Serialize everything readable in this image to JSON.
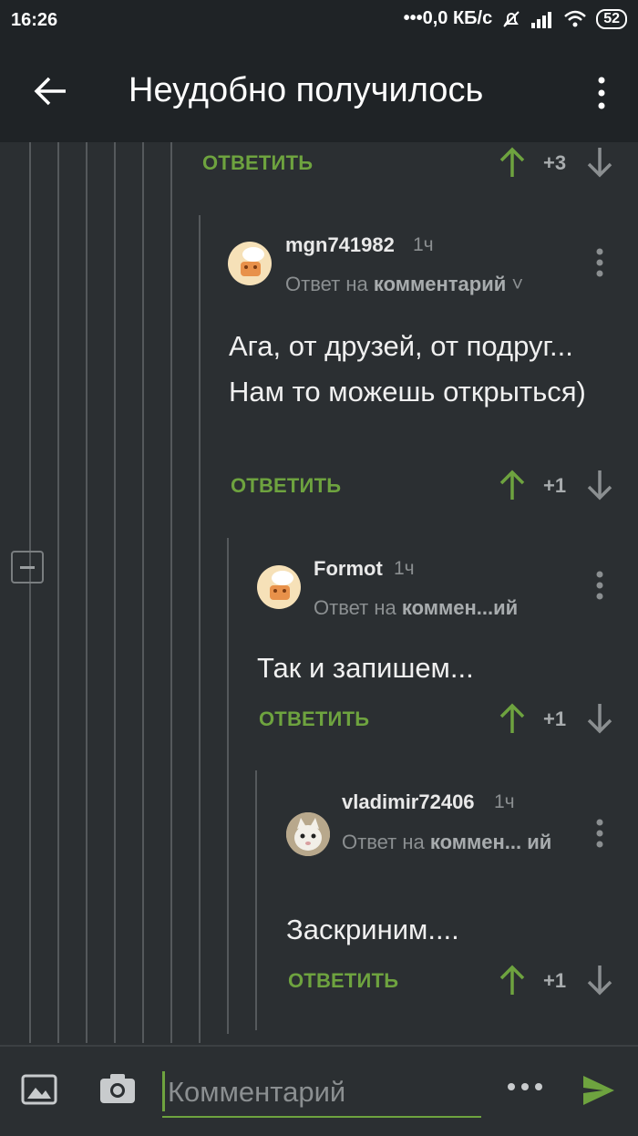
{
  "status_bar": {
    "time": "16:26",
    "network": "0,0 КБ/с",
    "battery": "52"
  },
  "header": {
    "title": "Неудобно получилось"
  },
  "colors": {
    "accent_green": "#6ea33f",
    "background": "#2b2f32",
    "topbar": "#1f2326"
  },
  "top_actions": {
    "reply_label": "ОТВЕТИТЬ",
    "score": "+3"
  },
  "comments": [
    {
      "username": "mgn741982",
      "time": "1ч",
      "reply_prefix": "Ответ на",
      "reply_target": "комментарий",
      "text": "Ага, от друзей, от подруг... Нам то можешь открыться)",
      "reply_label": "ОТВЕТИТЬ",
      "score": "+1"
    },
    {
      "username": "Formot",
      "time": "1ч",
      "reply_prefix": "Ответ на",
      "reply_target": "коммен...ий",
      "text": "Так и запишем...",
      "reply_label": "ОТВЕТИТЬ",
      "score": "+1"
    },
    {
      "username": "vladimir72406",
      "time": "1ч",
      "reply_prefix": "Ответ на",
      "reply_target": "коммен... ий",
      "text": "Заскриним....",
      "reply_label": "ОТВЕТИТЬ",
      "score": "+1"
    }
  ],
  "composer": {
    "placeholder": "Комментарий"
  }
}
